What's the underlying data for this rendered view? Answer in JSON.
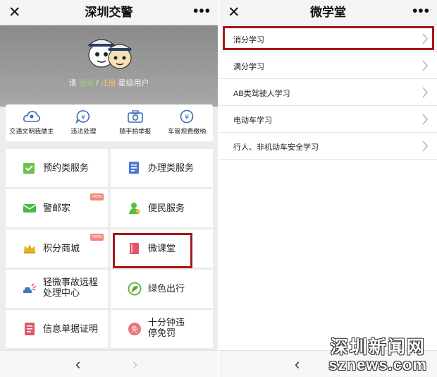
{
  "left": {
    "title": "深圳交警",
    "close": "✕",
    "more": "•••",
    "banner": {
      "please": "请",
      "login": "登录",
      "slash": " / ",
      "register": "注册",
      "suffix": " 星级用户"
    },
    "quick": [
      {
        "label": "交通文明我做主",
        "icon": "cloud-user-icon"
      },
      {
        "label": "违法处理",
        "icon": "yuan-speech-icon"
      },
      {
        "label": "随手拍举报",
        "icon": "camera-icon"
      },
      {
        "label": "车管规费缴纳",
        "icon": "yuan-circle-icon"
      }
    ],
    "services": [
      {
        "label": "预约类服务",
        "icon": "calendar-check-icon"
      },
      {
        "label": "办理类服务",
        "icon": "document-edit-icon"
      },
      {
        "label": "警邮家",
        "icon": "envelope-icon",
        "badge": "new"
      },
      {
        "label": "便民服务",
        "icon": "person-service-icon"
      },
      {
        "label": "积分商城",
        "icon": "crown-icon",
        "badge": "new"
      },
      {
        "label": "微课堂",
        "icon": "book-icon"
      },
      {
        "label": "轻微事故远程处理中心",
        "icon": "car-crash-icon"
      },
      {
        "label": "绿色出行",
        "icon": "green-leaf-icon"
      },
      {
        "label": "信息单据证明",
        "icon": "receipt-icon"
      },
      {
        "label": "十分钟违停免罚",
        "icon": "exempt-badge-icon",
        "badge_text": "免"
      }
    ],
    "nav": {
      "back": "‹",
      "forward": "›"
    }
  },
  "right": {
    "title": "微学堂",
    "close": "✕",
    "more": "•••",
    "items": [
      "消分学习",
      "满分学习",
      "AB类驾驶人学习",
      "电动车学习",
      "行人、非机动车安全学习"
    ],
    "nav": {
      "back": "‹"
    }
  },
  "watermark": {
    "cn": "深圳新闻网",
    "en": "sznews.com"
  },
  "colors": {
    "highlight": "#a4171c",
    "accent_green": "#8ed07a",
    "accent_orange": "#f3c15c"
  }
}
